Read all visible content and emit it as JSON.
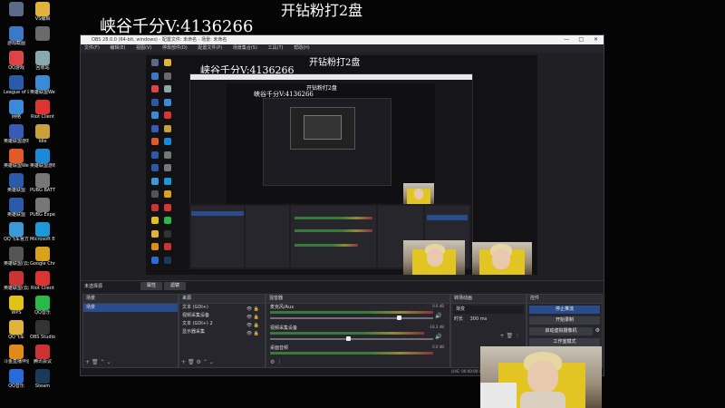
{
  "desktop_icons": [
    {
      "label": "",
      "color": "#5a6b8a"
    },
    {
      "label": "VS编辑",
      "color": "#e0b43a"
    },
    {
      "label": "游戏截图",
      "color": "#3a78c8"
    },
    {
      "label": "",
      "color": "#6a6a6a"
    },
    {
      "label": "QQ游戏",
      "color": "#d44"
    },
    {
      "label": "回收站",
      "color": "#8aa"
    },
    {
      "label": "League of Legends",
      "color": "#2a5aa8"
    },
    {
      "label": "英雄联盟WeGame版",
      "color": "#3a8ad8"
    },
    {
      "label": "网络",
      "color": "#3a8ad8"
    },
    {
      "label": "Riot Client",
      "color": "#d33"
    },
    {
      "label": "英雄联盟游戏",
      "color": "#3a5ab8"
    },
    {
      "label": "Idle",
      "color": "#c9a13a"
    },
    {
      "label": "英雄联盟WeGame版",
      "color": "#e05a2a"
    },
    {
      "label": "英雄联盟游戏客户端",
      "color": "#1a8ad8"
    },
    {
      "label": "英雄联盟",
      "color": "#2a5aa8"
    },
    {
      "label": "PUBG BATTLEGR...",
      "color": "#777"
    },
    {
      "label": "英雄联盟",
      "color": "#2a5aa8"
    },
    {
      "label": "PUBG Experime...",
      "color": "#777"
    },
    {
      "label": "QQ飞车官方工具",
      "color": "#3a9ad8"
    },
    {
      "label": "Microsoft Edge",
      "color": "#1a9ad8"
    },
    {
      "label": "英雄联盟(云游戏)",
      "color": "#555"
    },
    {
      "label": "Google Chrome",
      "color": "#d8a21a"
    },
    {
      "label": "英雄联盟(云游戏)",
      "color": "#c33"
    },
    {
      "label": "Riot Client",
      "color": "#d33"
    },
    {
      "label": "WPS",
      "color": "#e0c21a"
    },
    {
      "label": "QQ音乐",
      "color": "#2ab84a"
    },
    {
      "label": "QQ飞车",
      "color": "#e0b43a"
    },
    {
      "label": "OBS Studio",
      "color": "#333"
    },
    {
      "label": "斗鱼直播伴侣",
      "color": "#e08a1a"
    },
    {
      "label": "腾讯会议",
      "color": "#c33"
    },
    {
      "label": "QQ音乐",
      "color": "#2a6ad8"
    },
    {
      "label": "Steam",
      "color": "#1a3a5a"
    }
  ],
  "overlay": {
    "top_center": "开钻粉打2盘",
    "top_left": "峡谷千分V:4136266",
    "inner_top_center": "开钻粉打2盘",
    "inner_top_left": "峡谷千分V:4136266",
    "deep_top_center": "开钻粉打2盘",
    "deep_top_left": "峡谷千分V:4136266"
  },
  "obs": {
    "title": "OBS 28.0.0 (64-bit, windows) - 配置文件: 未命名 - 场景: 未命名",
    "menu": [
      "文件(F)",
      "编辑(E)",
      "视图(V)",
      "停靠部件(D)",
      "配置文件(P)",
      "场景集合(S)",
      "工具(T)",
      "帮助(H)"
    ],
    "toolbar": {
      "source_label": "未选择源",
      "properties": "属性",
      "filters": "滤镜"
    },
    "scenes": {
      "title": "场景",
      "items": [
        "场景"
      ]
    },
    "sources": {
      "title": "来源",
      "items": [
        "文本 (GDI+)",
        "视频采集设备",
        "文本 (GDI+) 2",
        "显示器采集"
      ]
    },
    "mixer": {
      "title": "混音器",
      "channels": [
        {
          "name": "麦克风/Aux",
          "db": "0.0 dB"
        },
        {
          "name": "视频采集设备",
          "db": "-18.3 dB"
        },
        {
          "name": "桌面音频",
          "db": "0.0 dB"
        }
      ]
    },
    "transitions": {
      "title": "转场动画",
      "type": "渐变",
      "duration_label": "时长",
      "duration": "300 ms"
    },
    "controls": {
      "title": "控件",
      "buttons": [
        "停止推流",
        "开始录制",
        "启动虚拟摄像机",
        "工作室模式"
      ]
    },
    "status": "LIVE: 00:00:00  CPU: 0.0%  30.00 / 30.00 FPS"
  },
  "colors": {
    "accent": "#2a4c8c",
    "window_bg": "#1f1f24",
    "desktop_bg": "#050505"
  }
}
